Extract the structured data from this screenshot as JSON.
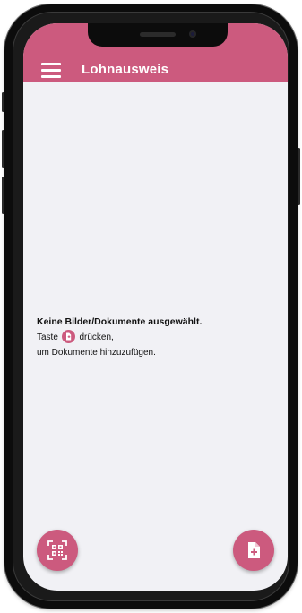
{
  "header": {
    "title": "Lohnausweis",
    "background_color": "#cc5a7e"
  },
  "empty_state": {
    "headline": "Keine Bilder/Dokumente ausgewählt.",
    "line2_before": "Taste",
    "line2_after": "drücken,",
    "line3": "um Dokumente hinzuzufügen.",
    "inline_icon": "add-document-icon"
  },
  "actions": {
    "scan_icon": "qr-scan-icon",
    "add_icon": "add-document-icon"
  },
  "colors": {
    "accent": "#cc5a7e",
    "background": "#f1f1f5",
    "text": "#111111"
  }
}
